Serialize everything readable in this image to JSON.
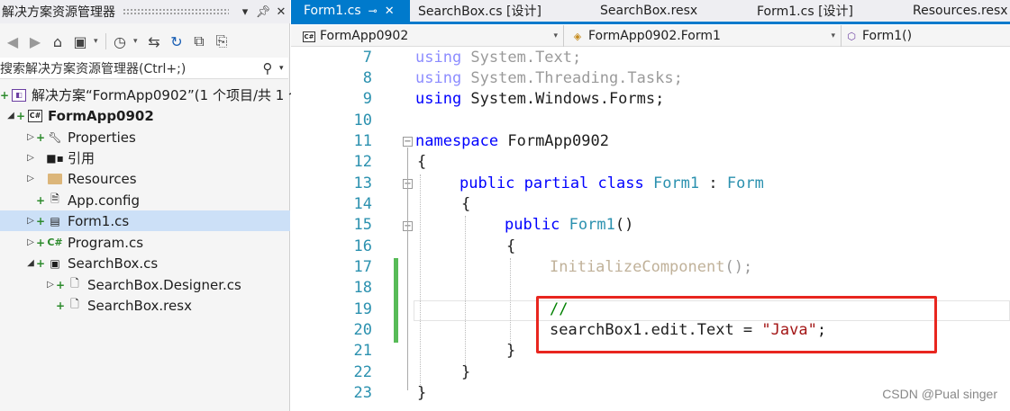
{
  "solution_explorer": {
    "title": "解决方案资源管理器",
    "search_placeholder": "搜索解决方案资源管理器(Ctrl+;)",
    "tree": [
      {
        "label": "解决方案“FormApp0902”(1 个项目/共 1 个",
        "icon": "solution-icon"
      },
      {
        "label": "FormApp0902",
        "icon": "csharp-project-icon"
      },
      {
        "label": "Properties",
        "icon": "wrench-icon"
      },
      {
        "label": "引用",
        "icon": "references-icon"
      },
      {
        "label": "Resources",
        "icon": "folder-icon"
      },
      {
        "label": "App.config",
        "icon": "config-file-icon"
      },
      {
        "label": "Form1.cs",
        "icon": "form-icon"
      },
      {
        "label": "Program.cs",
        "icon": "csharp-file-icon"
      },
      {
        "label": "SearchBox.cs",
        "icon": "usercontrol-icon"
      },
      {
        "label": "SearchBox.Designer.cs",
        "icon": "csharp-file-icon"
      },
      {
        "label": "SearchBox.resx",
        "icon": "resx-file-icon"
      }
    ]
  },
  "tabs": [
    {
      "label": "Form1.cs",
      "active": true
    },
    {
      "label": "SearchBox.cs [设计]"
    },
    {
      "label": "SearchBox.resx"
    },
    {
      "label": "Form1.cs [设计]"
    },
    {
      "label": "Resources.resx"
    }
  ],
  "navbar": {
    "project": "FormApp0902",
    "class": "FormApp0902.Form1",
    "member": "Form1()"
  },
  "code": {
    "line_numbers": [
      "7",
      "8",
      "9",
      "10",
      "11",
      "12",
      "13",
      "14",
      "15",
      "16",
      "17",
      "18",
      "19",
      "20",
      "21",
      "22",
      "23"
    ],
    "l7_kw": "using",
    "l7_rest": " System.Text;",
    "l8_kw": "using",
    "l8_rest": " System.Threading.Tasks;",
    "l9_kw": "using",
    "l9_rest": " System.Windows.Forms;",
    "l11_kw": "namespace",
    "l11_rest": " FormApp0902",
    "l12": "{",
    "l13_kw": "public partial class",
    "l13_sp": " ",
    "l13_ty": "Form1",
    "l13_colon": " : ",
    "l13_base": "Form",
    "l14": "{",
    "l15_kw": "public",
    "l15_sp": " ",
    "l15_ty": "Form1",
    "l15_rest": "()",
    "l16": "{",
    "l17_fn": "InitializeComponent",
    "l17_rest": "();",
    "l19": "//",
    "l20_a": "searchBox1.edit.Text = ",
    "l20_str": "\"Java\"",
    "l20_end": ";",
    "l21": "}",
    "l22": "}",
    "l23": "}"
  },
  "watermark": "CSDN @Pual singer",
  "colors": {
    "accent": "#007acc",
    "highlight_box": "#e8261f",
    "change_bar": "#57bb57"
  }
}
